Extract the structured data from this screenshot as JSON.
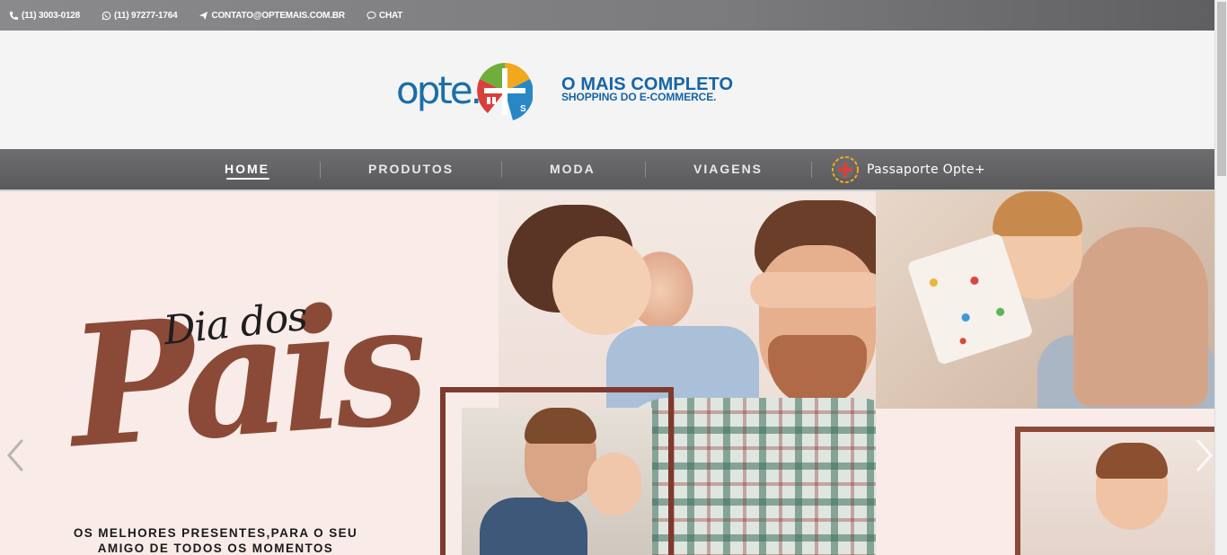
{
  "topbar": {
    "phone": "(11) 3003-0128",
    "whatsapp": "(11) 97277-1764",
    "email": "CONTATO@OPTEMAIS.COM.BR",
    "chat": "CHAT"
  },
  "header": {
    "logo_text": "opte.",
    "tagline_line1": "O MAIS COMPLETO",
    "tagline_line2": "SHOPPING DO E-COMMERCE."
  },
  "nav": {
    "items": [
      {
        "label": "HOME",
        "active": true
      },
      {
        "label": "PRODUTOS"
      },
      {
        "label": "MODA"
      },
      {
        "label": "VIAGENS"
      }
    ],
    "passaporte_label": "Passaporte Opte+"
  },
  "banner": {
    "headline_script": "Dia dos",
    "headline_big": "Pais",
    "subtitle_line1": "OS MELHORES PRESENTES,PARA O SEU",
    "subtitle_line2": "AMIGO DE TODOS OS MOMENTOS"
  },
  "colors": {
    "brand_blue": "#1565a8",
    "banner_bg": "#f8ebe8",
    "headline_copper": "#8b4a37",
    "nav_bg": "#5f5f62"
  },
  "icons": [
    "phone-icon",
    "whatsapp-icon",
    "send-icon",
    "chat-bubble-icon",
    "passport-badge-icon",
    "chevron-left-icon",
    "chevron-right-icon"
  ]
}
